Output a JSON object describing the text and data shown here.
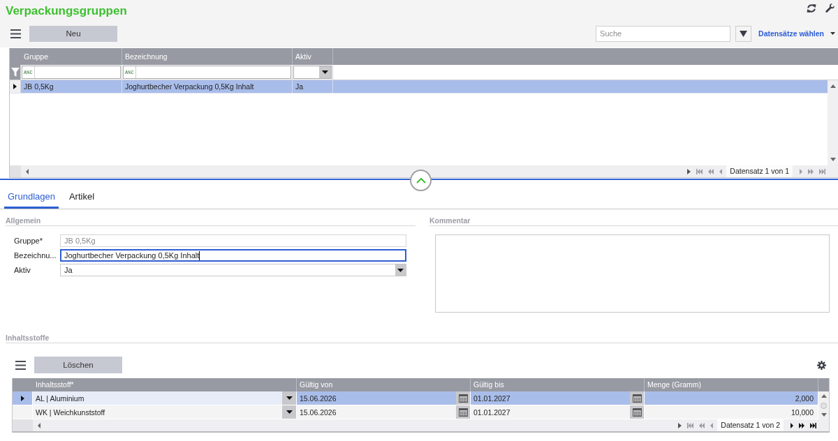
{
  "header": {
    "title": "Verpackungsgruppen",
    "toolbar": {
      "new_button": "Neu",
      "search": {
        "placeholder": "Suche"
      },
      "records_menu": "Datensätze wählen"
    }
  },
  "groups_grid": {
    "columns": [
      "Gruppe",
      "Bezeichnung",
      "Aktiv"
    ],
    "filters": [
      {
        "kind": "text",
        "operator": "A%C"
      },
      {
        "kind": "text",
        "operator": "A%C"
      },
      {
        "kind": "select"
      }
    ],
    "rows": [
      {
        "selected": true,
        "cells": [
          "JB 0,5Kg",
          "Joghurtbecher Verpackung 0,5Kg Inhalt",
          "Ja"
        ]
      }
    ],
    "pager": {
      "status": "Datensatz 1 von 1",
      "back_disabled": true,
      "forward_disabled": true
    }
  },
  "tabs": [
    {
      "label": "Grundlagen",
      "selected": true
    },
    {
      "label": "Artikel",
      "selected": false
    }
  ],
  "general": {
    "title": "Allgemein",
    "fields": [
      {
        "label": "Gruppe*",
        "kind": "text",
        "value": "JB 0,5Kg",
        "disabled": true,
        "focused": false
      },
      {
        "label": "Bezeichnu...",
        "kind": "text",
        "value": "Joghurtbecher Verpackung 0,5Kg Inhalt",
        "disabled": false,
        "focused": true
      },
      {
        "label": "Aktiv",
        "kind": "select",
        "value": "Ja",
        "disabled": false,
        "focused": false
      }
    ]
  },
  "comment": {
    "title": "Kommentar"
  },
  "ingredients": {
    "title": "Inhaltsstoffe",
    "delete_button": "Löschen",
    "grid": {
      "columns": [
        {
          "label": "Inhaltsstoff*",
          "kind": "select"
        },
        {
          "label": "Gültig von",
          "kind": "date"
        },
        {
          "label": "Gültig bis",
          "kind": "date"
        },
        {
          "label": "Menge (Gramm)",
          "kind": "number"
        }
      ],
      "rows": [
        {
          "selected": true,
          "cells": [
            "AL | Aluminium",
            "15.06.2026",
            "01.01.2027",
            "2,000"
          ]
        },
        {
          "selected": false,
          "cells": [
            "WK | Weichkunststoff",
            "15.06.2026",
            "01.01.2027",
            "10,000"
          ]
        }
      ],
      "pager": {
        "status": "Datensatz 1 von 2",
        "back_disabled": true,
        "forward_disabled": false
      }
    }
  }
}
